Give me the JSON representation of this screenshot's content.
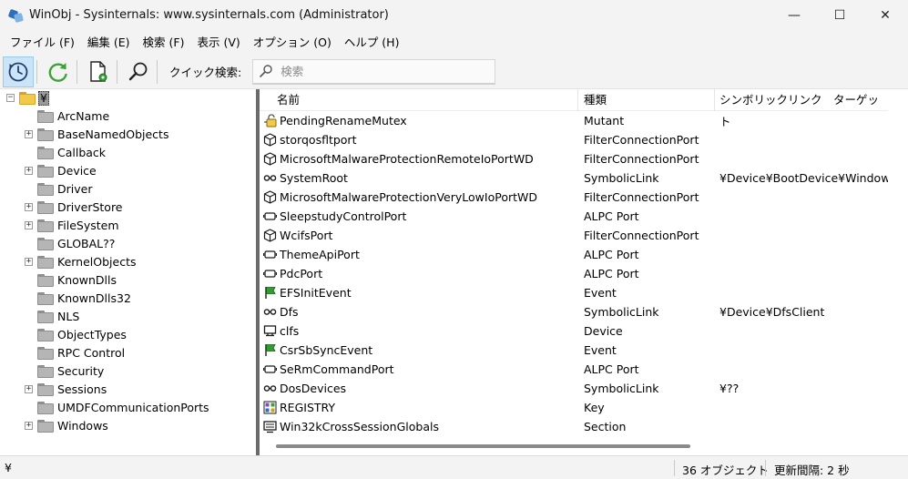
{
  "window": {
    "title": "WinObj - Sysinternals: www.sysinternals.com (Administrator)",
    "minimize_glyph": "—",
    "maximize_glyph": "☐",
    "close_glyph": "✕"
  },
  "menu": [
    "ファイル (F)",
    "編集 (E)",
    "検索 (F)",
    "表示 (V)",
    "オプション (O)",
    "ヘルプ (H)"
  ],
  "toolbar": {
    "buttons": [
      "auto-refresh-icon",
      "refresh-icon",
      "properties-icon",
      "find-icon"
    ],
    "quick_search_label": "クイック検索:",
    "search_placeholder": "検索"
  },
  "tree": {
    "root_label": "¥",
    "items": [
      {
        "label": "ArcName",
        "expandable": false
      },
      {
        "label": "BaseNamedObjects",
        "expandable": true
      },
      {
        "label": "Callback",
        "expandable": false
      },
      {
        "label": "Device",
        "expandable": true
      },
      {
        "label": "Driver",
        "expandable": false
      },
      {
        "label": "DriverStore",
        "expandable": true
      },
      {
        "label": "FileSystem",
        "expandable": true
      },
      {
        "label": "GLOBAL??",
        "expandable": false
      },
      {
        "label": "KernelObjects",
        "expandable": true
      },
      {
        "label": "KnownDlls",
        "expandable": false
      },
      {
        "label": "KnownDlls32",
        "expandable": false
      },
      {
        "label": "NLS",
        "expandable": false
      },
      {
        "label": "ObjectTypes",
        "expandable": false
      },
      {
        "label": "RPC Control",
        "expandable": false
      },
      {
        "label": "Security",
        "expandable": false
      },
      {
        "label": "Sessions",
        "expandable": true
      },
      {
        "label": "UMDFCommunicationPorts",
        "expandable": false
      },
      {
        "label": "Windows",
        "expandable": true
      }
    ]
  },
  "list": {
    "columns": [
      "名前",
      "種類",
      "シンボリックリンク　ターゲット"
    ],
    "rows": [
      {
        "name": "PendingRenameMutex",
        "type": "Mutant",
        "target": "",
        "icon": "mutant-icon"
      },
      {
        "name": "storqosfltport",
        "type": "FilterConnectionPort",
        "target": "",
        "icon": "filter-port-icon"
      },
      {
        "name": "MicrosoftMalwareProtectionRemoteIoPortWD",
        "type": "FilterConnectionPort",
        "target": "",
        "icon": "filter-port-icon"
      },
      {
        "name": "SystemRoot",
        "type": "SymbolicLink",
        "target": "¥Device¥BootDevice¥Windows",
        "icon": "symlink-icon"
      },
      {
        "name": "MicrosoftMalwareProtectionVeryLowIoPortWD",
        "type": "FilterConnectionPort",
        "target": "",
        "icon": "filter-port-icon"
      },
      {
        "name": "SleepstudyControlPort",
        "type": "ALPC Port",
        "target": "",
        "icon": "alpc-port-icon"
      },
      {
        "name": "WcifsPort",
        "type": "FilterConnectionPort",
        "target": "",
        "icon": "filter-port-icon"
      },
      {
        "name": "ThemeApiPort",
        "type": "ALPC Port",
        "target": "",
        "icon": "alpc-port-icon"
      },
      {
        "name": "PdcPort",
        "type": "ALPC Port",
        "target": "",
        "icon": "alpc-port-icon"
      },
      {
        "name": "EFSInitEvent",
        "type": "Event",
        "target": "",
        "icon": "event-flag-icon"
      },
      {
        "name": "Dfs",
        "type": "SymbolicLink",
        "target": "¥Device¥DfsClient",
        "icon": "symlink-icon"
      },
      {
        "name": "clfs",
        "type": "Device",
        "target": "",
        "icon": "device-icon"
      },
      {
        "name": "CsrSbSyncEvent",
        "type": "Event",
        "target": "",
        "icon": "event-flag-icon"
      },
      {
        "name": "SeRmCommandPort",
        "type": "ALPC Port",
        "target": "",
        "icon": "alpc-port-icon"
      },
      {
        "name": "DosDevices",
        "type": "SymbolicLink",
        "target": "¥??",
        "icon": "symlink-icon"
      },
      {
        "name": "REGISTRY",
        "type": "Key",
        "target": "",
        "icon": "registry-key-icon"
      },
      {
        "name": "Win32kCrossSessionGlobals",
        "type": "Section",
        "target": "",
        "icon": "section-icon"
      }
    ]
  },
  "status": {
    "path": "¥",
    "count": "36 オブジェクト",
    "refresh": "更新間隔: 2 秒"
  },
  "colors": {
    "accent_blue": "#1f6fbf",
    "refresh_green": "#3aa335",
    "event_green": "#2e9e2e",
    "folder_yellow": "#f2c94c",
    "splitter": "#6b6b6b"
  }
}
